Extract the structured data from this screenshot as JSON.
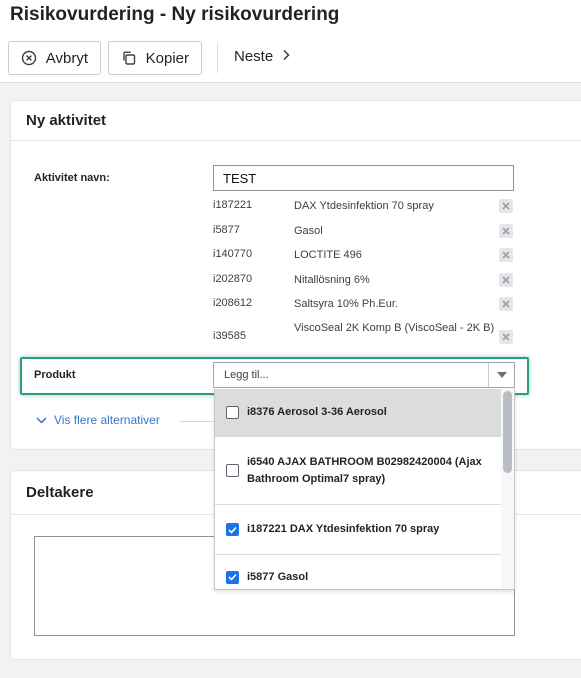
{
  "page": {
    "title": "Risikovurdering - Ny risikovurdering"
  },
  "toolbar": {
    "cancel_label": "Avbryt",
    "copy_label": "Kopier",
    "next_label": "Neste"
  },
  "activity_panel": {
    "header": "Ny aktivitet",
    "name_label": "Aktivitet navn:",
    "name_value": "TEST",
    "products": [
      {
        "id": "i187221",
        "name": "DAX Ytdesinfektion 70 spray"
      },
      {
        "id": "i5877",
        "name": "Gasol"
      },
      {
        "id": "i140770",
        "name": "LOCTITE 496"
      },
      {
        "id": "i202870",
        "name": "Nitallösning 6%"
      },
      {
        "id": "i208612",
        "name": "Saltsyra 10% Ph.Eur."
      },
      {
        "id": "i39585",
        "name": "ViscoSeal 2K Komp B (ViscoSeal - 2K B)"
      }
    ],
    "product_label": "Produkt",
    "product_select_placeholder": "Legg til...",
    "more_options_label": "Vis flere alternativer"
  },
  "participants_panel": {
    "header": "Deltakere"
  },
  "dropdown": {
    "options": [
      {
        "label": "i8376 Aerosol 3-36 Aerosol",
        "checked": false,
        "highlighted": true
      },
      {
        "label": "i6540 AJAX BATHROOM B02982420004 (Ajax Bathroom Optimal7 spray)",
        "checked": false,
        "highlighted": false
      },
      {
        "label": "i187221 DAX Ytdesinfektion 70 spray",
        "checked": true,
        "highlighted": false
      },
      {
        "label": "i5877 Gasol",
        "checked": true,
        "highlighted": false
      }
    ]
  },
  "colors": {
    "accent": "#2a9d84",
    "link": "#3873c9",
    "checkbox": "#1a73e8",
    "highlight_row": "#dcdcdc"
  }
}
